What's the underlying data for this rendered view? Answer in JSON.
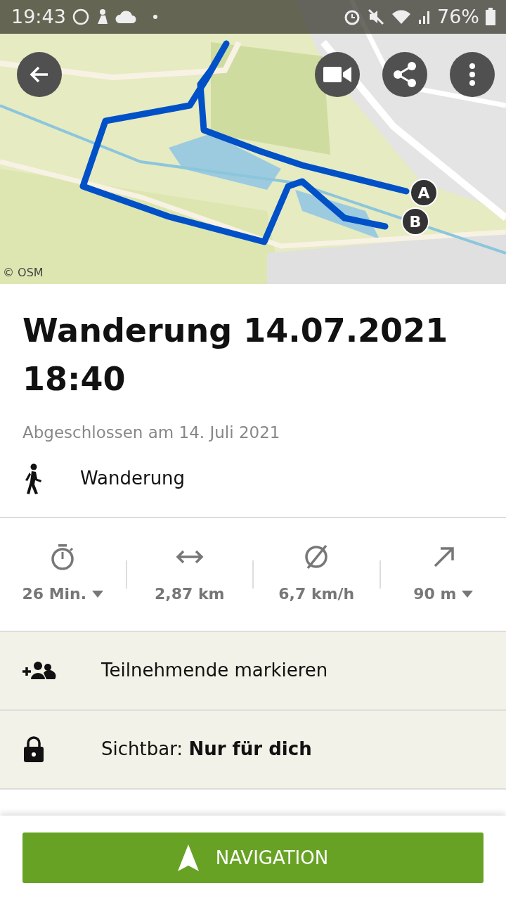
{
  "status_bar": {
    "time": "19:43",
    "battery": "76%"
  },
  "map": {
    "kind": "picture",
    "attribution": "© OSM",
    "markers": [
      {
        "label": "A"
      },
      {
        "label": "B"
      }
    ]
  },
  "title": "Wanderung 14.07.2021 18:40",
  "subtitle": "Abgeschlossen am 14. Juli 2021",
  "activity": {
    "label": "Wanderung"
  },
  "stats": [
    {
      "kind": "duration",
      "value": "26 Min.",
      "dropdown": true
    },
    {
      "kind": "distance",
      "value": "2,87 km",
      "dropdown": false
    },
    {
      "kind": "speed",
      "value": "6,7 km/h",
      "dropdown": false
    },
    {
      "kind": "ascent",
      "value": "90 m",
      "dropdown": true
    }
  ],
  "actions": [
    {
      "kind": "participants",
      "text": "Teilnehmende markieren"
    },
    {
      "kind": "visibility",
      "text": "Sichtbar: **Nur für dich**"
    }
  ],
  "button": {
    "label": "NAVIGATION"
  }
}
